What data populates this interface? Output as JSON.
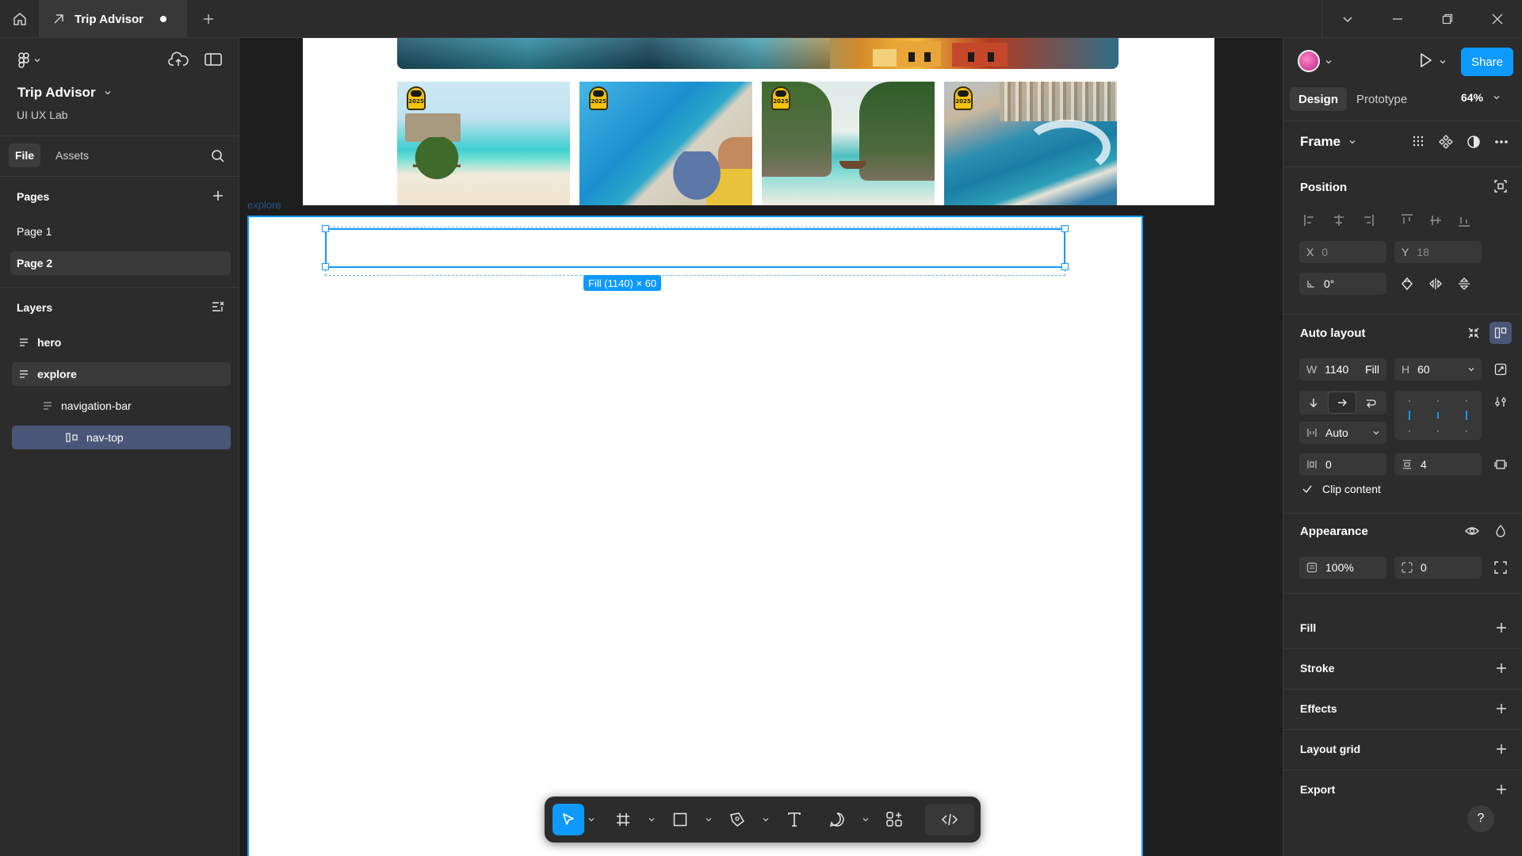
{
  "titlebar": {
    "tab_title": "Trip Advisor",
    "icons": [
      "home-icon",
      "file-icon",
      "unsaved-dot",
      "plus-icon",
      "chevron-down-icon",
      "minimize-icon",
      "restore-icon",
      "close-icon"
    ]
  },
  "left_panel": {
    "project_title": "Trip Advisor",
    "project_subtitle": "UI UX Lab",
    "tabs": {
      "file": "File",
      "assets": "Assets"
    },
    "pages_title": "Pages",
    "pages": [
      {
        "label": "Page 1",
        "active": false
      },
      {
        "label": "Page 2",
        "active": true
      }
    ],
    "layers_title": "Layers",
    "layers": [
      {
        "label": "hero",
        "depth": 0,
        "state": "normal"
      },
      {
        "label": "explore",
        "depth": 0,
        "state": "highlight"
      },
      {
        "label": "navigation-bar",
        "depth": 1,
        "state": "normal"
      },
      {
        "label": "nav-top",
        "depth": 1,
        "state": "selected"
      }
    ]
  },
  "canvas": {
    "explore_frame_label": "explore",
    "selection_size_label": "Fill (1140) × 60",
    "photo_badges": [
      "2025",
      "2025",
      "2025",
      "2025"
    ],
    "selection_color": "#0d99ff"
  },
  "toolbar": {
    "tools": [
      "move-tool",
      "frame-tool",
      "rectangle-tool",
      "pen-tool",
      "text-tool",
      "comment-tool",
      "actions-tool",
      "dev-mode-toggle"
    ]
  },
  "right_panel": {
    "share_label": "Share",
    "tabs": {
      "design": "Design",
      "prototype": "Prototype"
    },
    "zoom": "64%",
    "frame_label": "Frame",
    "position": {
      "title": "Position",
      "x_label": "X",
      "x_value": "0",
      "y_label": "Y",
      "y_value": "18",
      "rotation": "0°"
    },
    "auto_layout": {
      "title": "Auto layout",
      "w_label": "W",
      "w_value": "1140",
      "w_mode": "Fill",
      "h_label": "H",
      "h_value": "60",
      "gap_mode": "Auto",
      "padding_h": "0",
      "padding_v": "4",
      "clip_content": "Clip content"
    },
    "appearance": {
      "title": "Appearance",
      "opacity": "100%",
      "radius": "0"
    },
    "sections": [
      "Fill",
      "Stroke",
      "Effects",
      "Layout grid",
      "Export"
    ],
    "help": "?"
  }
}
